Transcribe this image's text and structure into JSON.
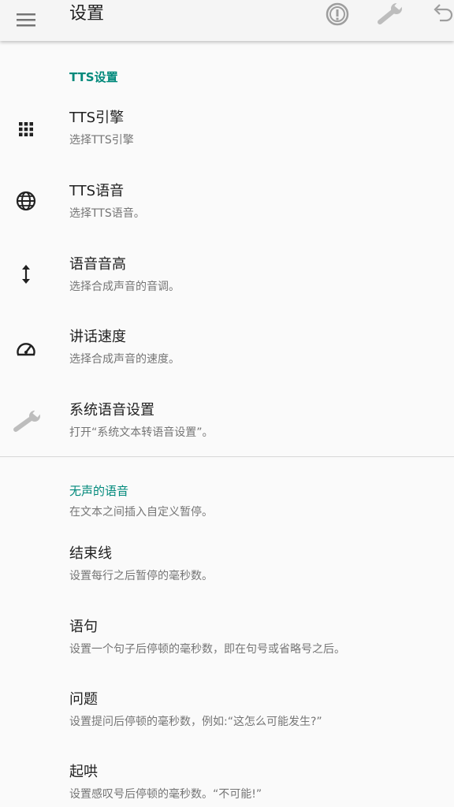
{
  "app_bar": {
    "title": "设置",
    "menu_icon": "hamburger-menu-icon",
    "actions": [
      {
        "icon": "info-circle-icon"
      },
      {
        "icon": "wrench-icon"
      },
      {
        "icon": "undo-icon"
      }
    ]
  },
  "tts_section": {
    "header": "TTS设置",
    "items": [
      {
        "title": "TTS引擎",
        "summary": "选择TTS引擎",
        "icon": "grid-dots-icon"
      },
      {
        "title": "TTS语音",
        "summary": "选择TTS语音。",
        "icon": "globe-icon"
      },
      {
        "title": "语音音高",
        "summary": "选择合成声音的音调。",
        "icon": "vertical-arrows-icon"
      },
      {
        "title": "讲话速度",
        "summary": "选择合成声音的速度。",
        "icon": "speedometer-icon"
      },
      {
        "title": "系统语音设置",
        "summary": "打开“系统文本转语音设置”。",
        "icon": "wrench-icon"
      }
    ]
  },
  "silence_section": {
    "header": "无声的语音",
    "description": "在文本之间插入自定义暂停。",
    "items": [
      {
        "title": "结束线",
        "summary": "设置每行之后暂停的毫秒数。"
      },
      {
        "title": "语句",
        "summary": "设置一个句子后停顿的毫秒数，即在句号或省略号之后。"
      },
      {
        "title": "问题",
        "summary": "设置提问后停顿的毫秒数，例如:“这怎么可能发生?”"
      },
      {
        "title": "起哄",
        "summary": "设置感叹号后停顿的毫秒数。“不可能!”"
      }
    ]
  },
  "colors": {
    "accent": "#00897b",
    "icon": "#212121",
    "icon_muted": "#bdbdbd",
    "background": "#fafafa"
  }
}
